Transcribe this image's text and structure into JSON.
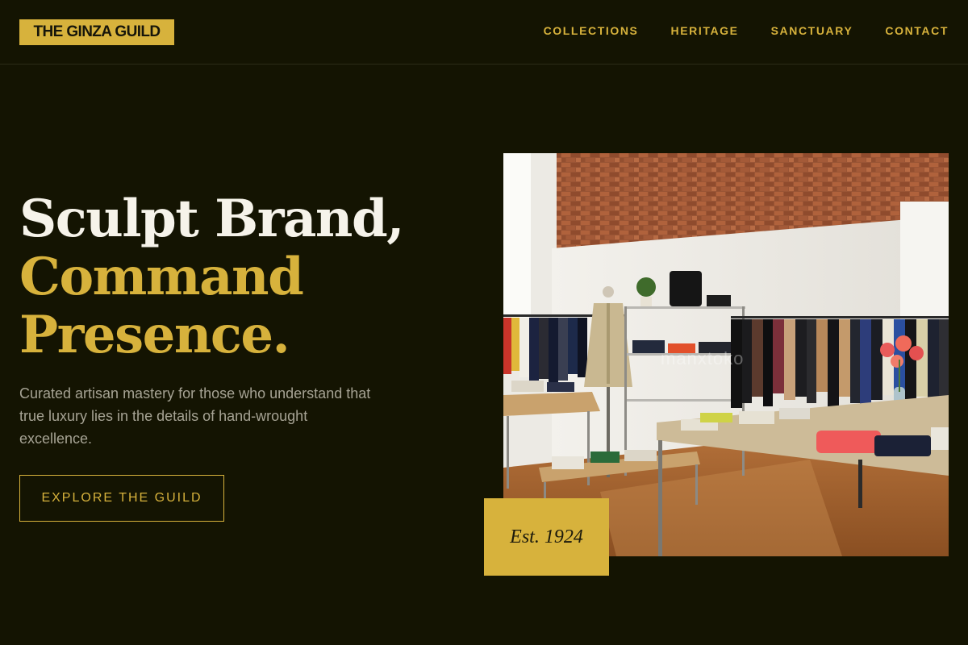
{
  "brand": {
    "name": "THE GINZA GUILD",
    "accent_color": "#d7b23c",
    "background_color": "#141402"
  },
  "nav": {
    "items": [
      "COLLECTIONS",
      "HERITAGE",
      "SANCTUARY",
      "CONTACT"
    ]
  },
  "hero": {
    "headline_line1": "Sculpt Brand,",
    "headline_line2": "Command",
    "headline_line3": "Presence.",
    "description": "Curated artisan mastery for those who understand that true luxury lies in the details of hand-wrought excellence.",
    "cta_label": "EXPLORE THE GUILD"
  },
  "image": {
    "depicts": "boutique-interior-photo",
    "overlay_text": "manxtoko"
  },
  "badge": {
    "label": "Est. 1924"
  }
}
